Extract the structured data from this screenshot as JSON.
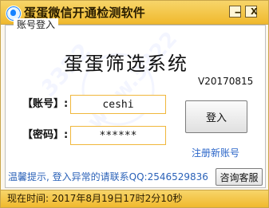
{
  "window": {
    "title": "蛋蛋微信开通检测软件",
    "minimize_symbol": "🗕",
    "close_symbol": "X"
  },
  "panel": {
    "title": "账号登入",
    "heading": "蛋蛋筛选系统",
    "version": "V20170815"
  },
  "form": {
    "account_label": "【账号】:",
    "password_label": "【密码】:",
    "account_value": "ceshi",
    "password_value": "******",
    "login_button": "登入",
    "register_link": "注册新账号"
  },
  "footer": {
    "notice": "温馨提示, 登入异常的请联系QQ:2546529836",
    "support_button": "咨询客服",
    "status_text": "现在时间: 2017年8月19日17时2分10秒"
  },
  "colors": {
    "titlebar": "#f0b92d",
    "accent_border": "#f0b73b",
    "link": "#2b66c9"
  },
  "icons": {
    "app": "app-logo-icon",
    "minimize": "minimize-icon",
    "close": "close-icon"
  }
}
